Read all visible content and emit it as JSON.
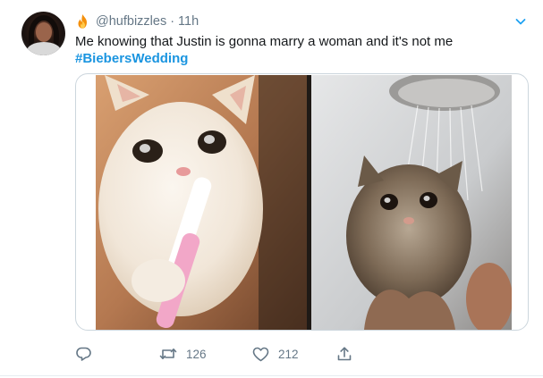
{
  "tweet": {
    "author_handle": "@hufbizzles",
    "separator": "·",
    "timestamp": "11h",
    "badge_icon": "fire-icon",
    "text": "Me knowing that Justin is gonna marry a woman and it's not me",
    "hashtag": "#BiebersWedding",
    "media": {
      "type": "photo",
      "panels": [
        "crying-cat-with-toothbrush",
        "wet-crying-cat-in-shower"
      ]
    },
    "actions": {
      "reply_icon": "reply-icon",
      "retweet_icon": "retweet-icon",
      "retweet_count": "126",
      "like_icon": "heart-icon",
      "like_count": "212",
      "share_icon": "share-icon"
    }
  },
  "colors": {
    "text": "#14171a",
    "secondary_text": "#657786",
    "hashtag": "#1b95e0",
    "caret": "#1da1f2",
    "border": "#ccd6dd",
    "fire": "#f4900c"
  }
}
